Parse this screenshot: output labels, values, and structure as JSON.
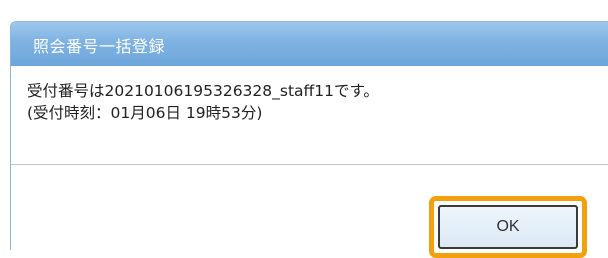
{
  "dialog": {
    "title": "照会番号一括登録",
    "message_line1": "受付番号は20210106195326328_staff11です。",
    "message_line2": "(受付時刻：01月06日 19時53分)",
    "ok_label": "OK"
  },
  "colors": {
    "titlebar": "#7fb2e2",
    "highlight": "#f2a00e"
  }
}
